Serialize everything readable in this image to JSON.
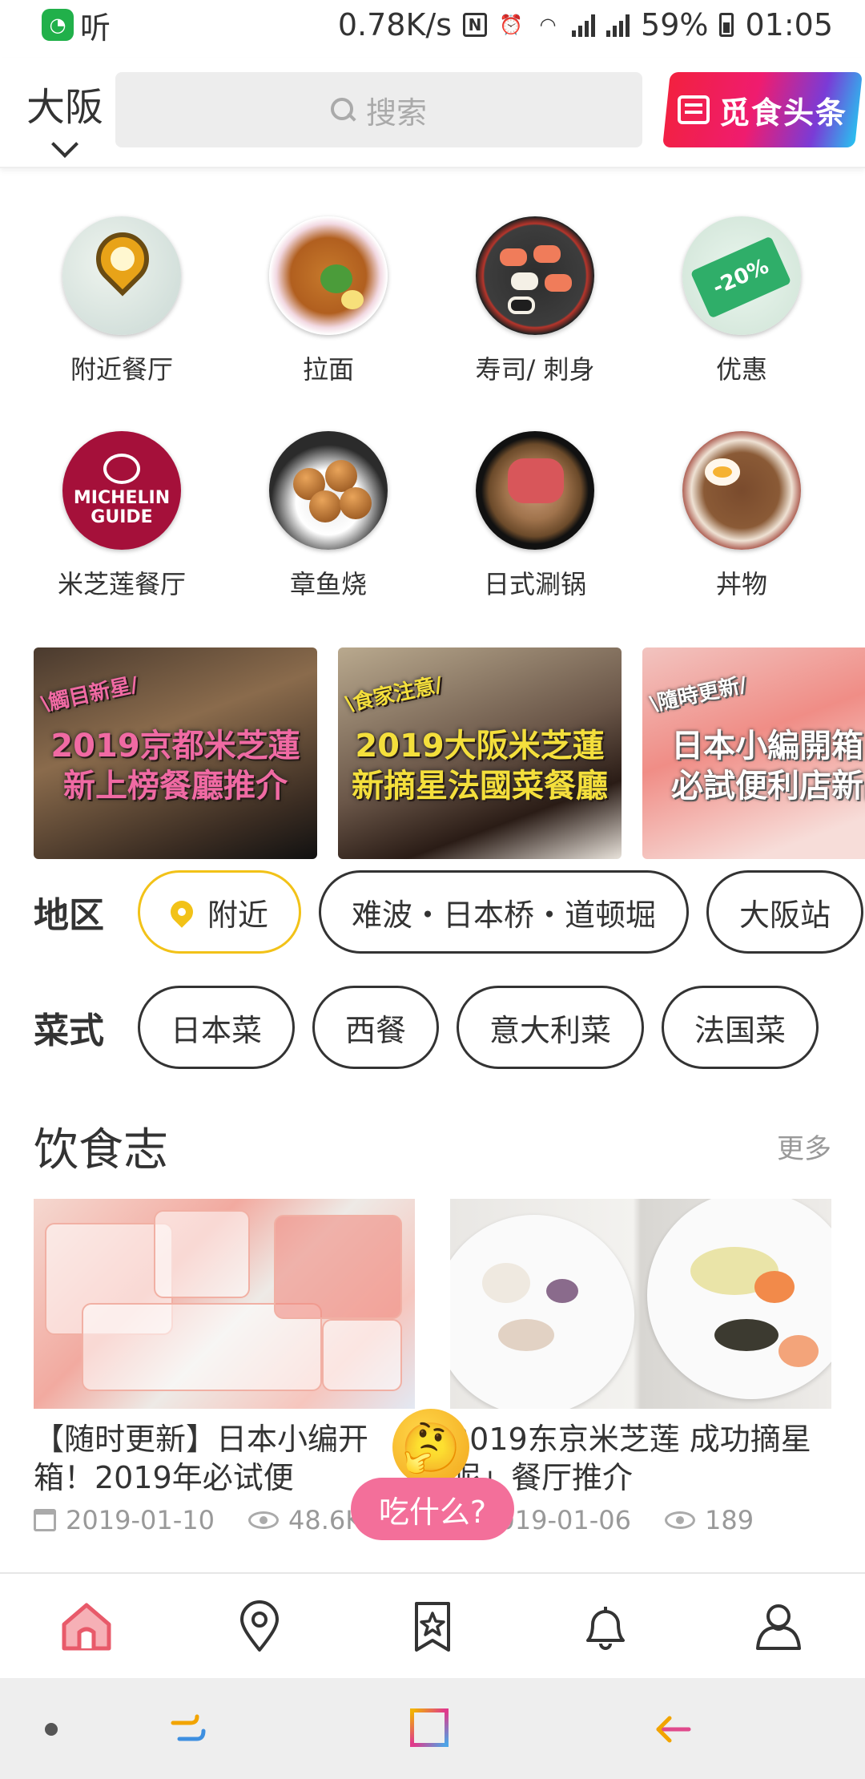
{
  "status_bar": {
    "app_label": "听",
    "net_speed": "0.78K/s",
    "network": "4G",
    "battery": "59%",
    "time": "01:05"
  },
  "header": {
    "city": "大阪",
    "search_placeholder": "搜索",
    "headline_label": "觅食头条"
  },
  "categories": [
    {
      "label": "附近餐厅",
      "icon": "map-pin-icon"
    },
    {
      "label": "拉面",
      "icon": "ramen-icon"
    },
    {
      "label": "寿司/ 刺身",
      "icon": "sushi-icon"
    },
    {
      "label": "优惠",
      "icon": "coupon-icon"
    },
    {
      "label": "米芝莲餐厅",
      "icon": "michelin-icon",
      "badge_text": "MICHELIN GUIDE"
    },
    {
      "label": "章鱼烧",
      "icon": "takoyaki-icon"
    },
    {
      "label": "日式涮锅",
      "icon": "shabu-icon"
    },
    {
      "label": "丼物",
      "icon": "donburi-icon"
    }
  ],
  "banners": [
    {
      "tag": "\\觸目新星/",
      "title_line1": "2019京都米芝蓮",
      "title_line2": "新上榜餐廳推介"
    },
    {
      "tag": "\\食家注意/",
      "title_line1": "2019大阪米芝蓮",
      "title_line2": "新摘星法國菜餐廳"
    },
    {
      "tag": "\\隨時更新/",
      "title_line1": "日本小編開箱",
      "title_line2": "必試便利店新品"
    }
  ],
  "filters": {
    "region": {
      "label": "地区",
      "chips": [
        "附近",
        "难波・日本桥・道顿堀",
        "大阪站"
      ]
    },
    "cuisine": {
      "label": "菜式",
      "chips": [
        "日本菜",
        "西餐",
        "意大利菜",
        "法国菜"
      ]
    }
  },
  "journal": {
    "title": "饮食志",
    "more": "更多",
    "articles": [
      {
        "title": "【随时更新】日本小编开箱！2019年必试便",
        "date": "2019-01-10",
        "views": "48.6K"
      },
      {
        "title": "2019东京米芝莲 成功摘星呢」餐厅推介",
        "date": "2019-01-06",
        "views": "189"
      }
    ]
  },
  "fab": {
    "label": "吃什么?",
    "emoji": "🤔"
  },
  "tabbar": [
    "home-icon",
    "location-icon",
    "bookmark-star-icon",
    "bell-icon",
    "profile-icon"
  ],
  "colors": {
    "accent_yellow": "#f2c218",
    "fab_pink": "#f36f9a",
    "home_tab": "#e85a6a"
  }
}
